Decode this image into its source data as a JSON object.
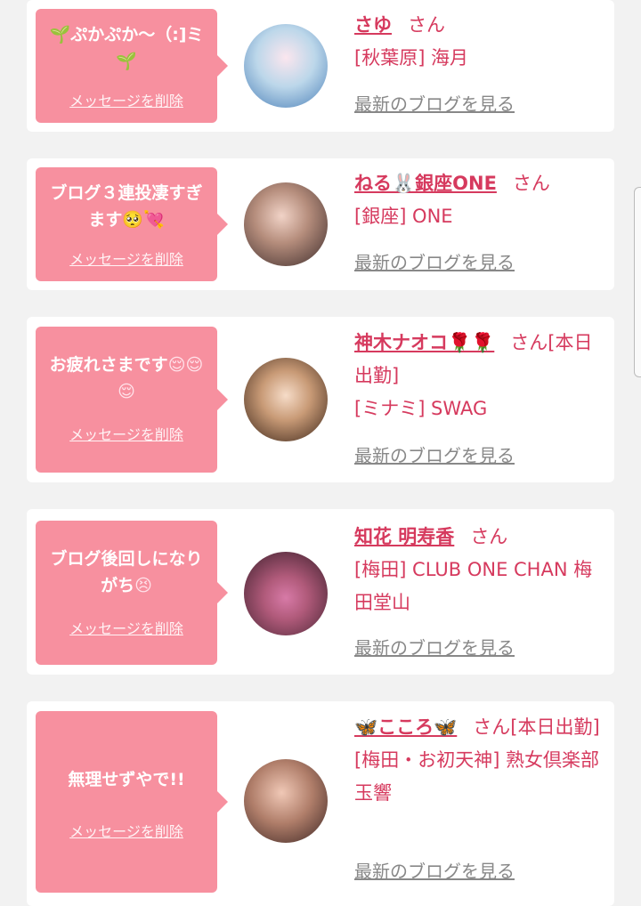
{
  "cards": [
    {
      "message": "ぷかぷか〜（:]ミ",
      "message_emoji_lead": "🌱",
      "message_emoji_tail": "🌱",
      "delete_label": "メッセージを削除",
      "name": "さゆ",
      "honorific": "さん",
      "shop": "[秋葉原] 海月",
      "blog_link": "最新のブログを見る"
    },
    {
      "message": "ブログ３連投凄すぎます",
      "message_emoji_tail": "🥺💘",
      "delete_label": "メッセージを削除",
      "name": "ねる🐰銀座ONE",
      "honorific": "さん",
      "shop": "[銀座] ONE",
      "blog_link": "最新のブログを見る"
    },
    {
      "message": "お疲れさまです",
      "message_emoji_tail": "😌😌😌",
      "delete_label": "メッセージを削除",
      "name": "神木ナオコ🌹🌹",
      "honorific": "さん[本日出勤]",
      "shop": "[ミナミ] SWAG",
      "blog_link": "最新のブログを見る"
    },
    {
      "message": "ブログ後回しになりがち",
      "message_emoji_tail": "😣",
      "delete_label": "メッセージを削除",
      "name": "知花 明寿香",
      "honorific": "さん",
      "shop": "[梅田] CLUB ONE CHAN 梅田堂山",
      "blog_link": "最新のブログを見る"
    },
    {
      "message": "無理せずやで!!",
      "delete_label": "メッセージを削除",
      "name": "🦋こころ🦋",
      "honorific": "さん[本日出勤]",
      "shop": "[梅田・お初天神] 熟女倶楽部 玉響",
      "blog_link": "最新のブログを見る"
    }
  ],
  "colors": {
    "accent": "#d63a5e",
    "bubble": "#f7909f",
    "background": "#f2f2f2",
    "link_gray": "#888888"
  }
}
